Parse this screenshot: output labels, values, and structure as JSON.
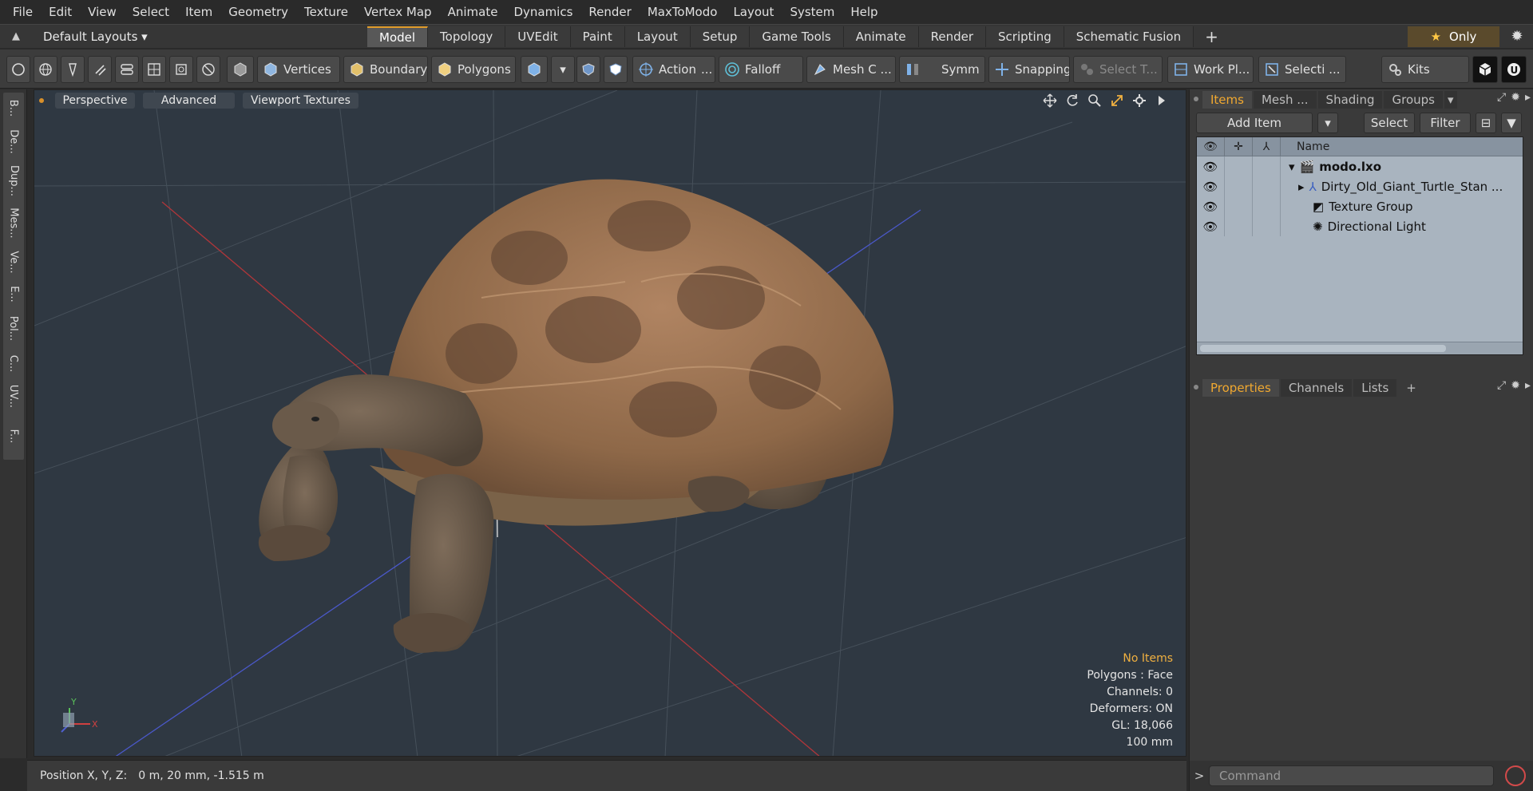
{
  "menu": [
    "File",
    "Edit",
    "View",
    "Select",
    "Item",
    "Geometry",
    "Texture",
    "Vertex Map",
    "Animate",
    "Dynamics",
    "Render",
    "MaxToModo",
    "Layout",
    "System",
    "Help"
  ],
  "layout_bar": {
    "layout_select": "Default Layouts ▾",
    "tabs": [
      "Model",
      "Topology",
      "UVEdit",
      "Paint",
      "Layout",
      "Setup",
      "Game Tools",
      "Animate",
      "Render",
      "Scripting",
      "Schematic Fusion"
    ],
    "active_tab": "Model",
    "plus": "+",
    "only_label": "Only"
  },
  "toolbar": {
    "vertices": "Vertices",
    "boundary": "Boundary",
    "polygons": "Polygons",
    "action": "Action",
    "action_more": "...",
    "falloff": "Falloff",
    "mesh_c": "Mesh C ...",
    "symm": "Symm ...",
    "snapping": "Snapping",
    "select_t": "Select T...",
    "work_pl": "Work Pl...",
    "selecti": "Selecti ...",
    "kits": "Kits"
  },
  "left_tabs": [
    "B...",
    "De...",
    "Dup...",
    "Mes...",
    "Ve...",
    "E...",
    "Pol...",
    "C...",
    "UV...",
    "F..."
  ],
  "viewport": {
    "tabs": [
      "Perspective",
      "Advanced",
      "Viewport Textures"
    ],
    "info": {
      "selection": "No Items",
      "polygons": "Polygons : Face",
      "channels": "Channels: 0",
      "deformers": "Deformers: ON",
      "gl": "GL: 18,066",
      "scale": "100 mm"
    },
    "axis_x": "X",
    "axis_y": "Y"
  },
  "status": {
    "label": "Position X, Y, Z:",
    "value": "0 m, 20 mm, -1.515 m"
  },
  "items_panel": {
    "tabs": [
      "Items",
      "Mesh ...",
      "Shading",
      "Groups"
    ],
    "active_tab": "Items",
    "add_item": "Add Item",
    "select": "Select",
    "filter": "Filter",
    "column_name": "Name",
    "rows": [
      {
        "name": "modo.lxo"
      },
      {
        "name": "Dirty_Old_Giant_Turtle_Stan ..."
      },
      {
        "name": "Texture Group"
      },
      {
        "name": "Directional Light"
      }
    ]
  },
  "properties_panel": {
    "tabs": [
      "Properties",
      "Channels",
      "Lists"
    ],
    "active_tab": "Properties",
    "plus": "+"
  },
  "command": {
    "placeholder": "Command",
    "arrow": ">"
  }
}
